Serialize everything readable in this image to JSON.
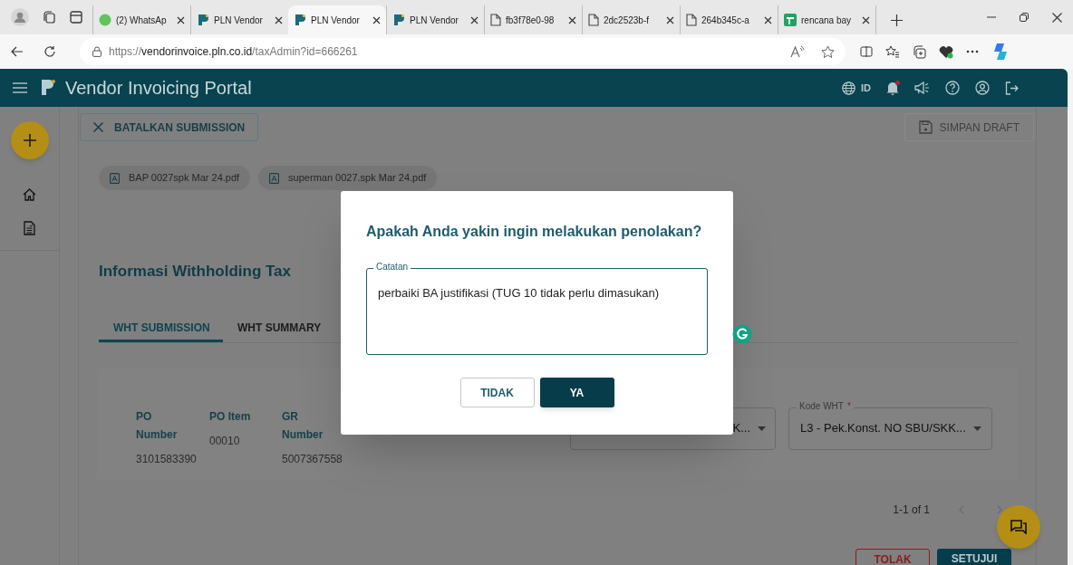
{
  "browser": {
    "tabs": [
      {
        "kind": "whatsapp",
        "label": "(2) WhatsAp",
        "selected": false
      },
      {
        "kind": "pln",
        "label": "PLN Vendor",
        "selected": false
      },
      {
        "kind": "pln",
        "label": "PLN Vendor",
        "selected": true
      },
      {
        "kind": "pln",
        "label": "PLN Vendor",
        "selected": false
      },
      {
        "kind": "file",
        "label": "fb3f78e0-98",
        "selected": false
      },
      {
        "kind": "file",
        "label": "2dc2523b-f",
        "selected": false
      },
      {
        "kind": "file",
        "label": "264b345c-a",
        "selected": false
      },
      {
        "kind": "sheet",
        "label": "rencana bay",
        "selected": false
      }
    ],
    "url": {
      "scheme": "https://",
      "host": "vendorinvoice.pln.co.id",
      "path": "/taxAdmin?id=666261"
    }
  },
  "header": {
    "title": "Vendor Invoicing Portal",
    "language": "ID",
    "notification": true
  },
  "toolbar": {
    "cancel": "BATALKAN SUBMISSION",
    "draft": {
      "label": "SIMPAN DRAFT",
      "disabled": true
    }
  },
  "attachments": [
    "BAP 0027spk Mar 24.pdf",
    "superman 0027.spk Mar 24.pdf"
  ],
  "section_title": "Informasi Withholding Tax",
  "tabs": [
    {
      "label": "WHT SUBMISSION",
      "selected": true
    },
    {
      "label": "WHT SUMMARY",
      "selected": false
    }
  ],
  "table": {
    "columns": [
      "PO Number",
      "PO Item",
      "GR Number"
    ],
    "row": [
      "3101583390",
      "00010",
      "5007367558"
    ],
    "selects": [
      {
        "value": "K..."
      },
      {
        "label": "Kode WHT",
        "required_mark": "*",
        "value": "L3 - Pek.Konst. NO SBU/SKK..."
      }
    ]
  },
  "pagination": "1-1 of 1",
  "actions": [
    {
      "kind": "reject",
      "label": "TOLAK"
    },
    {
      "kind": "approve",
      "label": "SETUJUI"
    }
  ],
  "dialog": {
    "title": "Apakah Anda yakin ingin melakukan penolakan?",
    "field_label": "Catatan",
    "value": "perbaiki BA justifikasi (TUG 10 tidak perlu dimasukan)",
    "buttons": [
      {
        "kind": "secondary",
        "label": "TIDAK"
      },
      {
        "kind": "primary",
        "label": "YA"
      }
    ]
  }
}
